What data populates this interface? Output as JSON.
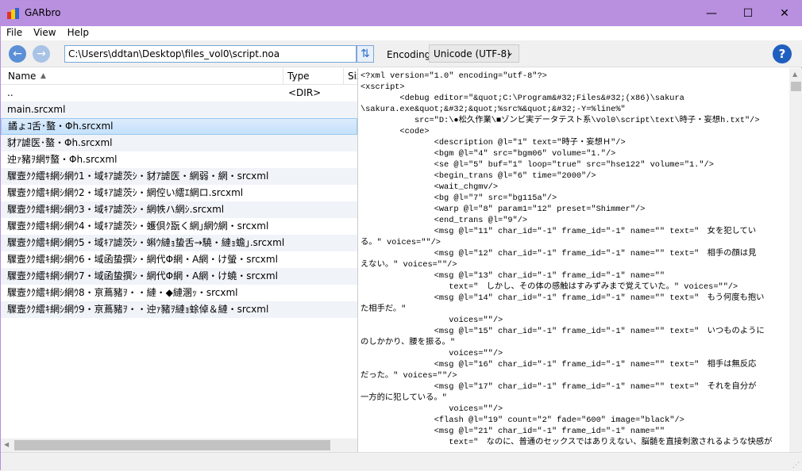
{
  "window": {
    "title": "GARbro",
    "minimize": "—",
    "maximize": "☐",
    "close": "✕"
  },
  "menu": [
    "File",
    "View",
    "Help"
  ],
  "toolbar": {
    "back": "←",
    "forward": "→",
    "path": "C:\\Users\\ddtan\\Desktop\\files_vol0\\script.noa",
    "refresh": "⇅",
    "encoding_label": "Encoding",
    "encoding_value": "Unicode (UTF-8)",
    "encoding_arrow": "⌄",
    "help": "?"
  },
  "columns": {
    "name": "Name",
    "sort": "▲",
    "type": "Type",
    "size": "Siz"
  },
  "files": [
    {
      "name": "..",
      "type": "<DIR>"
    },
    {
      "name": "main.srcxml",
      "type": ""
    },
    {
      "name": "譎ょｺ舌･螯・Φh.srcxml",
      "type": ""
    },
    {
      "name": "豺ｱ謔医･螯・Φh.srcxml",
      "type": ""
    },
    {
      "name": "迚ｧ豬ｦ網ｻ螯・Φh.srcxml",
      "type": ""
    },
    {
      "name": "驟壼ｸｸ繧ｷ網ｼ網ｳ1・域ｷｱ謔茨ｼ・豺ｱ謔医・網弱・網・srcxml",
      "type": ""
    },
    {
      "name": "驟壼ｸｸ繧ｷ網ｼ網ｳ2・域ｷｱ謔茨ｼ・網倥い繧ｴ網ロ.srcxml",
      "type": ""
    },
    {
      "name": "驟壼ｸｸ繧ｷ網ｼ網ｳ3・域ｷｱ謔茨ｼ・網帙ハ網ｼ.srcxml",
      "type": ""
    },
    {
      "name": "驟壼ｸｸ繧ｷ網ｼ網ｳ4・域ｷｱ謔茨ｼ・蠖倶ｸ翫く網｣網ｳ網・srcxml",
      "type": ""
    },
    {
      "name": "驟壼ｸｸ繧ｷ網ｼ網ｳ5・域ｷｱ謔茨ｼ・蝌ｳ縺ｮ蛰舌→驍・縺ｮ蟾｣.srcxml",
      "type": ""
    },
    {
      "name": "驟壼ｸｸ繧ｷ網ｼ網ｳ6・域函蛰撰ｼ・網代Φ網・A網・け螢・srcxml",
      "type": ""
    },
    {
      "name": "驟壼ｸｸ繧ｷ網ｼ網ｳ7・域函蛰撰ｼ・網代Φ網・A網・け蟯・srcxml",
      "type": ""
    },
    {
      "name": "驟壼ｸｸ繧ｷ網ｼ網ｳ8・亰蔦豬ｦ・・縺・◆縺溷ｯ・srcxml",
      "type": ""
    },
    {
      "name": "驟壼ｸｸ繧ｷ網ｼ網ｳ9・亰蔦豬ｦ・・迚ｧ豬ｦ縺ｮ蜍倬＆縺・srcxml",
      "type": ""
    }
  ],
  "selected_index": 2,
  "preview_lines": [
    "<?xml version=\"1.0\" encoding=\"utf-8\"?>",
    "<xscript>",
    "        <debug editor=\"&quot;C:\\Program&#32;Files&#32;(x86)\\sakura",
    "\\sakura.exe&quot;&#32;&quot;%src%&quot;&#32;-Y=%line%\"",
    "           src=\"D:\\●松久作業\\■ゾンビ実データテスト系\\vol0\\script\\text\\時子・妄想h.txt\"/>",
    "        <code>",
    "               <description @l=\"1\" text=\"時子・妄想Ｈ\"/>",
    "               <bgm @l=\"4\" src=\"bgm06\" volume=\"1.\"/>",
    "               <se @l=\"5\" buf=\"1\" loop=\"true\" src=\"hse122\" volume=\"1.\"/>",
    "               <begin_trans @l=\"6\" time=\"2000\"/>",
    "               <wait_chgmv/>",
    "               <bg @l=\"7\" src=\"bg115a\"/>",
    "               <warp @l=\"8\" param1=\"12\" preset=\"Shimmer\"/>",
    "               <end_trans @l=\"9\"/>",
    "               <msg @l=\"11\" char_id=\"-1\" frame_id=\"-1\" name=\"\" text=\"　女を犯してい",
    "る。\" voices=\"\"/>",
    "               <msg @l=\"12\" char_id=\"-1\" frame_id=\"-1\" name=\"\" text=\"　相手の顔は見",
    "えない。\" voices=\"\"/>",
    "               <msg @l=\"13\" char_id=\"-1\" frame_id=\"-1\" name=\"\"",
    "                  text=\"　しかし、その体の感触はすみずみまで覚えていた。\" voices=\"\"/>",
    "               <msg @l=\"14\" char_id=\"-1\" frame_id=\"-1\" name=\"\" text=\"　もう何度も抱い",
    "た相手だ。\"",
    "                  voices=\"\"/>",
    "               <msg @l=\"15\" char_id=\"-1\" frame_id=\"-1\" name=\"\" text=\"　いつものように",
    "のしかかり、腰を振る。\"",
    "                  voices=\"\"/>",
    "               <msg @l=\"16\" char_id=\"-1\" frame_id=\"-1\" name=\"\" text=\"　相手は無反応",
    "だった。\" voices=\"\"/>",
    "               <msg @l=\"17\" char_id=\"-1\" frame_id=\"-1\" name=\"\" text=\"　それを自分が",
    "一方的に犯している。\"",
    "                  voices=\"\"/>",
    "               <flash @l=\"19\" count=\"2\" fade=\"600\" image=\"black\"/>",
    "               <msg @l=\"21\" char_id=\"-1\" frame_id=\"-1\" name=\"\"",
    "                  text=\"　なのに、普通のセックスではありえない、脳髄を直接刺激されるような快感が"
  ]
}
